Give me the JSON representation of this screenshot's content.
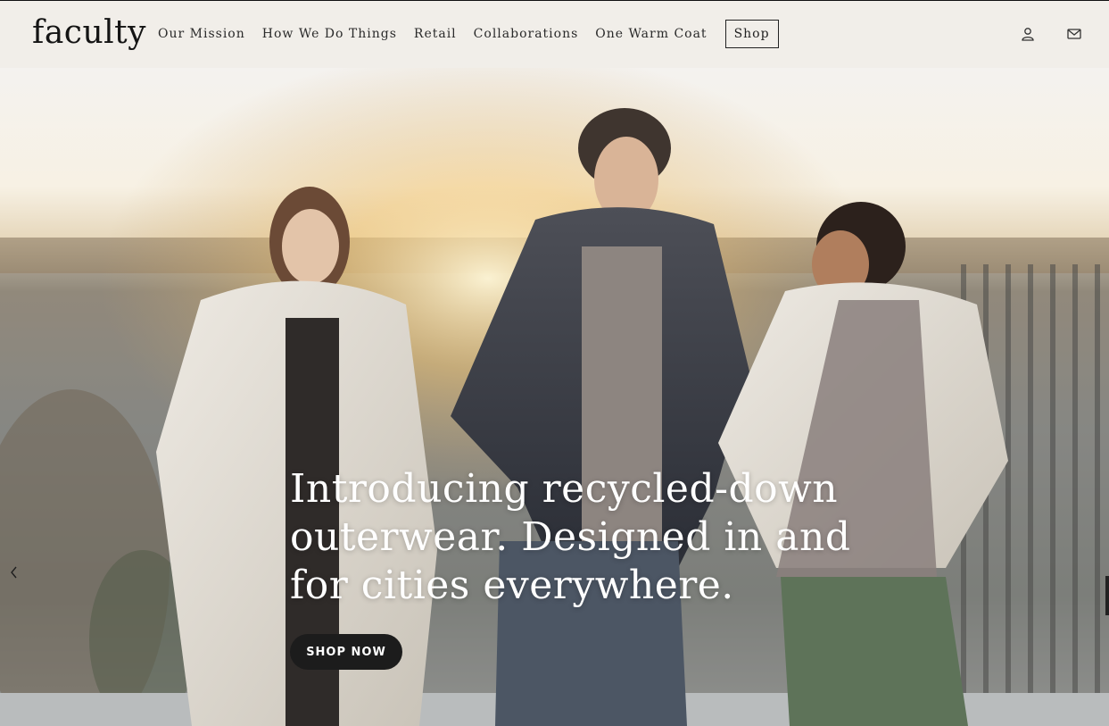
{
  "brand": {
    "logo": "faculty"
  },
  "nav": {
    "items": [
      "Our Mission",
      "How We Do Things",
      "Retail",
      "Collaborations",
      "One Warm Coat"
    ],
    "shop": "Shop"
  },
  "header_icons": {
    "account": "user-icon",
    "contact": "mail-icon"
  },
  "hero": {
    "lines": [
      "Introducing recycled-down",
      "outerwear. Designed in and",
      "for cities everywhere."
    ],
    "cta": "SHOP NOW",
    "prev_icon": "chevron-left-icon"
  },
  "colors": {
    "header_bg": "#f1eee9",
    "cta_bg": "#1c1c1c",
    "hero_text": "#ffffff"
  }
}
